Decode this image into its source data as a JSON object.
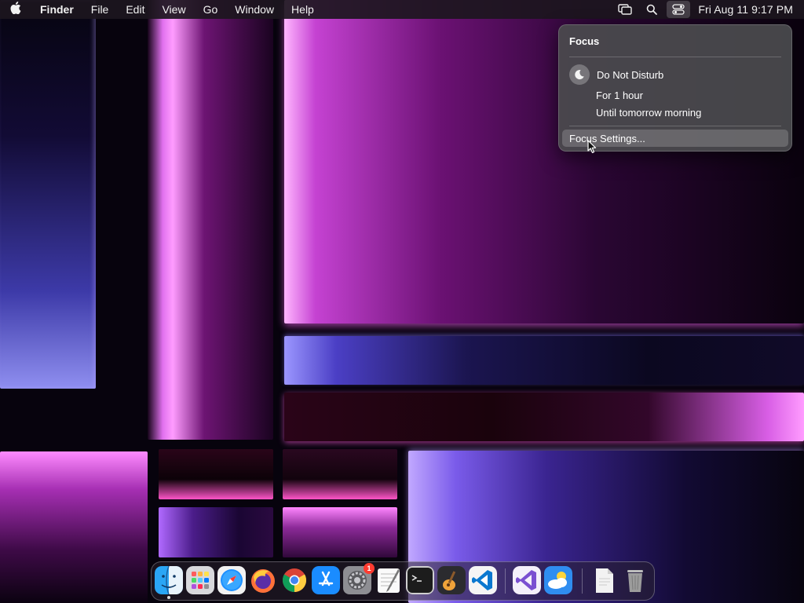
{
  "menubar": {
    "app_name": "Finder",
    "items": [
      "File",
      "Edit",
      "View",
      "Go",
      "Window",
      "Help"
    ],
    "status_icons": [
      "screen-mirroring-icon",
      "search-icon",
      "control-center-icon"
    ],
    "clock": "Fri Aug 11  9:17 PM"
  },
  "focus_menu": {
    "title": "Focus",
    "dnd_label": "Do Not Disturb",
    "options": [
      "For 1 hour",
      "Until tomorrow morning"
    ],
    "settings_label": "Focus Settings..."
  },
  "dock": {
    "apps": [
      {
        "name": "Finder",
        "icon": "finder-icon",
        "running": true
      },
      {
        "name": "Launchpad",
        "icon": "launchpad-icon"
      },
      {
        "name": "Safari",
        "icon": "safari-icon"
      },
      {
        "name": "Firefox",
        "icon": "firefox-icon"
      },
      {
        "name": "Chrome",
        "icon": "chrome-icon"
      },
      {
        "name": "App Store",
        "icon": "app-store-icon"
      },
      {
        "name": "System Settings",
        "icon": "system-settings-icon",
        "badge": "1"
      },
      {
        "name": "TextEdit",
        "icon": "textedit-icon"
      },
      {
        "name": "Terminal",
        "icon": "terminal-icon"
      },
      {
        "name": "Instruments",
        "icon": "instruments-icon"
      },
      {
        "name": "Visual Studio Code",
        "icon": "vscode-icon"
      },
      {
        "name": "Visual Studio",
        "icon": "visual-studio-icon"
      },
      {
        "name": "Weather",
        "icon": "weather-icon"
      },
      {
        "name": "Document",
        "icon": "document-icon"
      },
      {
        "name": "Trash",
        "icon": "trash-icon"
      }
    ]
  },
  "colors": {
    "menu_bg": "#1c161e",
    "popup_bg": "#4a4a4e",
    "highlight": "#6a6a6e",
    "badge": "#ff3b30"
  }
}
